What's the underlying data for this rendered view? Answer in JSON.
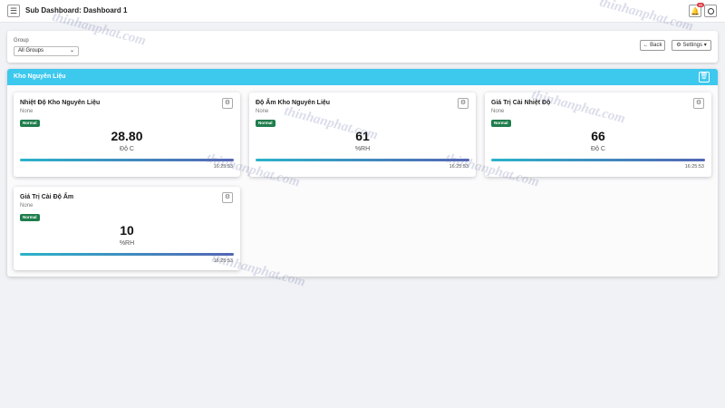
{
  "header": {
    "title": "Sub Dashboard: Dashboard 1",
    "menu_icon": "hamburger-icon",
    "notifications_count": "99",
    "notification_icon": "bell-icon",
    "theme_icon": "theme-toggle-icon"
  },
  "filter": {
    "group_label": "Group",
    "group_value": "All Groups",
    "back_label": "← Back",
    "settings_label": "⚙ Settings ▾"
  },
  "group": {
    "title": "Kho Nguyên Liệu",
    "header_color": "#3dc8ee"
  },
  "cards": [
    {
      "title": "Nhiệt Độ Kho Nguyên Liệu",
      "subtitle": "None",
      "status": "Normal",
      "value": "28.80",
      "unit": "Độ C",
      "time": "16:25:53"
    },
    {
      "title": "Độ Ẩm Kho Nguyên Liệu",
      "subtitle": "None",
      "status": "Normal",
      "value": "61",
      "unit": "%RH",
      "time": "16:25:53"
    },
    {
      "title": "Giá Trị Cài Nhiệt Độ",
      "subtitle": "None",
      "status": "Normal",
      "value": "66",
      "unit": "Độ C",
      "time": "16:25:53"
    },
    {
      "title": "Giá Trị Cài Độ Ẩm",
      "subtitle": "None",
      "status": "Normal",
      "value": "10",
      "unit": "%RH",
      "time": "16:25:53"
    }
  ],
  "colors": {
    "status_normal": "#1e7d4c",
    "bar_start": "#2bb3c9",
    "bar_end": "#5466b5"
  },
  "watermark": "thinhanphat.com"
}
